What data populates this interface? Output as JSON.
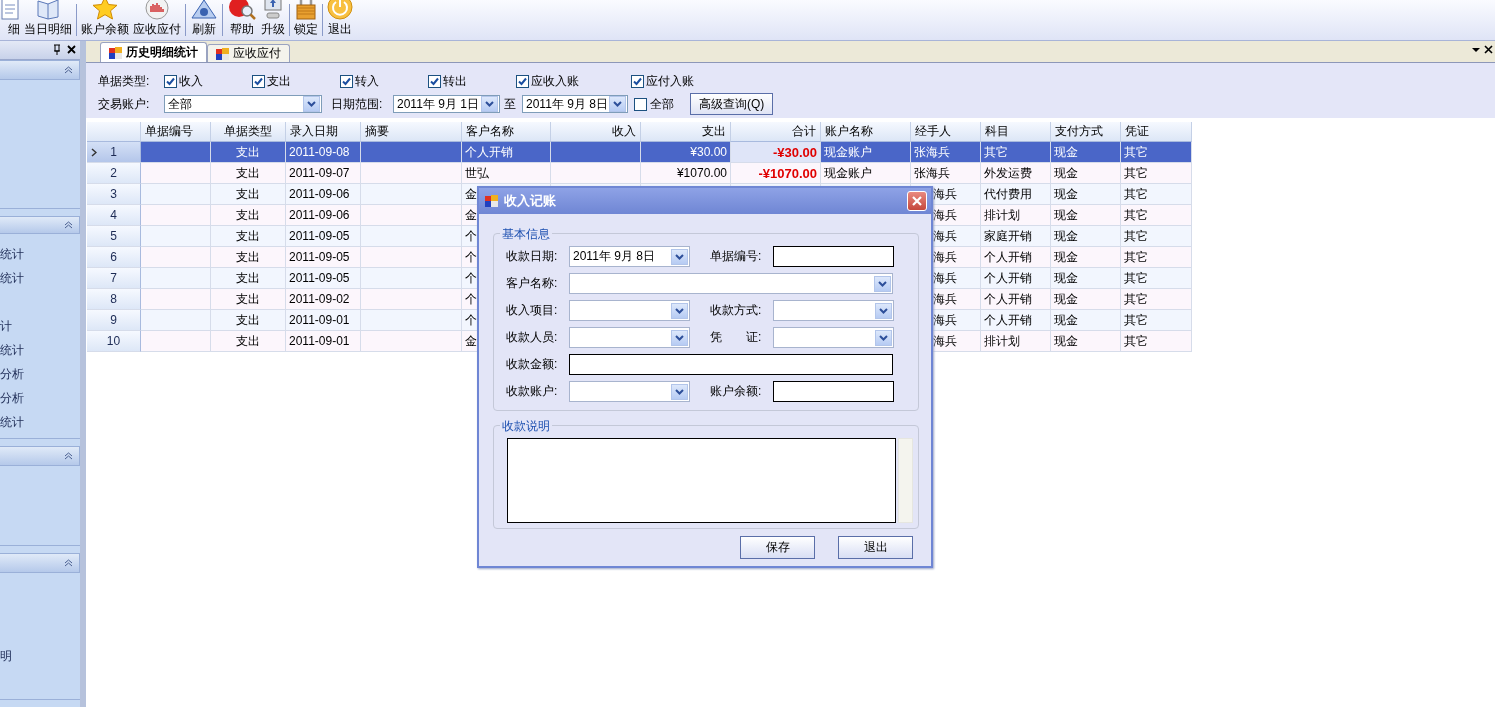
{
  "toolbar": {
    "items": [
      {
        "label": "细"
      },
      {
        "label": "当日明细"
      },
      {
        "label": "账户余额"
      },
      {
        "label": "应收应付"
      },
      {
        "label": "刷新"
      },
      {
        "label": "帮助"
      },
      {
        "label": "升级"
      },
      {
        "label": "锁定"
      },
      {
        "label": "退出"
      }
    ]
  },
  "left_panel": {
    "sections": [
      {
        "expanded": true
      },
      {
        "expanded": true,
        "items": [
          "统计",
          "统计",
          "计",
          "统计",
          "分析",
          "分析",
          "统计"
        ]
      },
      {
        "expanded": true
      },
      {
        "expanded": true,
        "items": [
          "明"
        ]
      }
    ]
  },
  "tabs": [
    {
      "label": "历史明细统计",
      "selected": true
    },
    {
      "label": "应收应付",
      "selected": false
    }
  ],
  "filter": {
    "doc_type_label": "单据类型:",
    "doc_types": [
      {
        "label": "收入",
        "checked": true
      },
      {
        "label": "支出",
        "checked": true
      },
      {
        "label": "转入",
        "checked": true
      },
      {
        "label": "转出",
        "checked": true
      },
      {
        "label": "应收入账",
        "checked": true
      },
      {
        "label": "应付入账",
        "checked": true
      }
    ],
    "account_label": "交易账户:",
    "account_value": "全部",
    "date_label": "日期范围:",
    "date_from": "2011年 9月 1日",
    "date_sep": "至",
    "date_to": "2011年 9月 8日",
    "all_checkbox": {
      "label": "全部",
      "checked": false
    },
    "advanced_button": "高级查询(Q)"
  },
  "table": {
    "columns": [
      "单据编号",
      "单据类型",
      "录入日期",
      "摘要",
      "客户名称",
      "收入",
      "支出",
      "合计",
      "账户名称",
      "经手人",
      "科目",
      "支付方式",
      "凭证"
    ],
    "rows": [
      {
        "number": "1",
        "selected": true,
        "cells": [
          null,
          "支出",
          "2011-09-08",
          null,
          "个人开销",
          null,
          "¥30.00",
          "-¥30.00",
          "现金账户",
          "张海兵",
          "其它",
          "现金",
          "其它"
        ]
      },
      {
        "number": "2",
        "selected": false,
        "cells": [
          null,
          "支出",
          "2011-09-07",
          null,
          "世弘",
          null,
          "¥1070.00",
          "-¥1070.00",
          "现金账户",
          "张海兵",
          "外发运费",
          "现金",
          "其它"
        ]
      },
      {
        "number": "3",
        "selected": false,
        "cells": [
          null,
          "支出",
          "2011-09-06",
          null,
          "金",
          null,
          null,
          null,
          null,
          "海兵",
          "代付费用",
          "现金",
          "其它"
        ]
      },
      {
        "number": "4",
        "selected": false,
        "cells": [
          null,
          "支出",
          "2011-09-06",
          null,
          "金",
          null,
          null,
          null,
          null,
          "海兵",
          "排计划",
          "现金",
          "其它"
        ]
      },
      {
        "number": "5",
        "selected": false,
        "cells": [
          null,
          "支出",
          "2011-09-05",
          null,
          "个",
          null,
          null,
          null,
          null,
          "海兵",
          "家庭开销",
          "现金",
          "其它"
        ]
      },
      {
        "number": "6",
        "selected": false,
        "cells": [
          null,
          "支出",
          "2011-09-05",
          null,
          "个",
          null,
          null,
          null,
          null,
          "海兵",
          "个人开销",
          "现金",
          "其它"
        ]
      },
      {
        "number": "7",
        "selected": false,
        "cells": [
          null,
          "支出",
          "2011-09-05",
          null,
          "个",
          null,
          null,
          null,
          null,
          "海兵",
          "个人开销",
          "现金",
          "其它"
        ]
      },
      {
        "number": "8",
        "selected": false,
        "cells": [
          null,
          "支出",
          "2011-09-02",
          null,
          "个",
          null,
          null,
          null,
          null,
          "海兵",
          "个人开销",
          "现金",
          "其它"
        ]
      },
      {
        "number": "9",
        "selected": false,
        "cells": [
          null,
          "支出",
          "2011-09-01",
          null,
          "个",
          null,
          null,
          null,
          null,
          "海兵",
          "个人开销",
          "现金",
          "其它"
        ]
      },
      {
        "number": "10",
        "selected": false,
        "cells": [
          null,
          "支出",
          "2011-09-01",
          null,
          "金",
          null,
          null,
          null,
          null,
          "海兵",
          "排计划",
          "现金",
          "其它"
        ]
      }
    ]
  },
  "dialog": {
    "title": "收入记账",
    "basic_info": {
      "title": "基本信息",
      "rows": [
        [
          {
            "label": "收款日期:",
            "kind": "date",
            "value": "2011年 9月 8日"
          },
          {
            "label": "单据编号:",
            "kind": "text"
          }
        ],
        [
          {
            "label": "客户名称:",
            "kind": "combo"
          }
        ],
        [
          {
            "label": "收入项目:",
            "kind": "combo"
          },
          {
            "label": "收款方式:",
            "kind": "combo"
          }
        ],
        [
          {
            "label": "收款人员:",
            "kind": "combo"
          },
          {
            "label": "凭　　证:",
            "kind": "combo"
          }
        ],
        [
          {
            "label": "收款金额:",
            "kind": "text"
          }
        ],
        [
          {
            "label": "收款账户:",
            "kind": "combo"
          },
          {
            "label": "账户余额:",
            "kind": "text"
          }
        ]
      ]
    },
    "note": {
      "title": "收款说明"
    },
    "buttons": [
      "保存",
      "退出"
    ]
  }
}
